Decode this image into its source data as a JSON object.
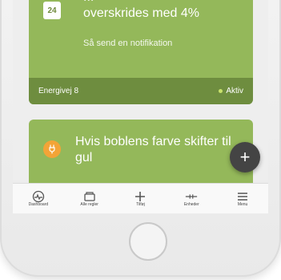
{
  "card1": {
    "date": "24",
    "title_top": "...",
    "title": "overskrides med 4%",
    "subtitle": "Så send en notifikation",
    "footer_left": "Energivej 8",
    "status": "Aktiv",
    "bg": "#94b85a",
    "footer_bg": "#6e8d3f"
  },
  "card2": {
    "icon": "plug-icon",
    "title": "Hvis boblens farve skifter til gul",
    "icon_color": "#f3a437"
  },
  "fab": {
    "label": "+"
  },
  "tabs": [
    {
      "icon": "dashboard-icon",
      "label": "Dashboard"
    },
    {
      "icon": "all-rules-icon",
      "label": "Alle regler"
    },
    {
      "icon": "add-icon",
      "label": "Tilføj"
    },
    {
      "icon": "devices-icon",
      "label": "Enheder"
    },
    {
      "icon": "menu-icon",
      "label": "Menu"
    }
  ]
}
